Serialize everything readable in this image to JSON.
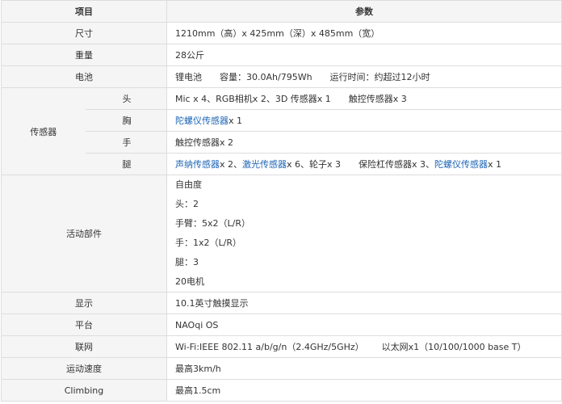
{
  "header": {
    "item": "项目",
    "params": "参数"
  },
  "rows": {
    "size": {
      "label": "尺寸",
      "value": "1210mm（高）x 425mm（深）x 485mm（宽）"
    },
    "weight": {
      "label": "重量",
      "value": "28公斤"
    },
    "battery": {
      "label": "电池",
      "type": "锂电池",
      "capacity": "容量：30.0Ah/795Wh",
      "runtime": "运行时间：约超过12小时"
    },
    "sensors": {
      "label": "传感器",
      "head": {
        "label": "头",
        "a": "Mic x 4、RGB相机x 2、3D 传感器x 1",
        "b": "触控传感器x 3"
      },
      "chest": {
        "label": "胸",
        "link": "陀螺仪传感器",
        "rest": "x 1"
      },
      "hand": {
        "label": "手",
        "value": "触控传感器x 2"
      },
      "leg": {
        "label": "腿",
        "link1": "声纳传感器",
        "t1": "x 2、",
        "link2": "激光传感器",
        "t2": "x 6、轮子x 3",
        "t3": "保险杠传感器x 3、",
        "link3": "陀螺仪传感器",
        "t4": "x 1"
      }
    },
    "moving_parts": {
      "label": "活动部件",
      "lines": [
        "自由度",
        "头：2",
        "手臂：5x2（L/R）",
        "手：1x2（L/R）",
        "腿：3",
        "20电机"
      ]
    },
    "display": {
      "label": "显示",
      "value": "10.1英寸触摸显示"
    },
    "platform": {
      "label": "平台",
      "value": "NAOqi OS"
    },
    "network": {
      "label": "联网",
      "wifi": "Wi-Fi:IEEE 802.11 a/b/g/n（2.4GHz/5GHz）",
      "ethernet": "以太网x1（10/100/1000 base T）"
    },
    "speed": {
      "label": "运动速度",
      "value": "最高3km/h"
    },
    "climbing": {
      "label": "Climbing",
      "value": "最高1.5cm"
    }
  },
  "colors": {
    "link": "#1b64b6",
    "header_bg": "#f5f5f5",
    "border": "#dddddd"
  }
}
